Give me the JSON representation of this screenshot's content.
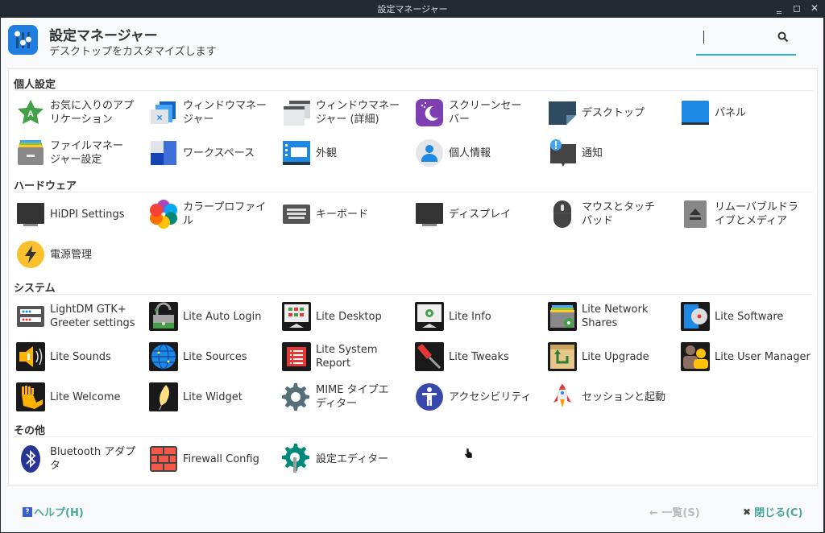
{
  "window": {
    "title": "設定マネージャー",
    "controls": [
      "minimize",
      "maximize",
      "close"
    ]
  },
  "header": {
    "title": "設定マネージャー",
    "subtitle": "デスクトップをカスタマイズします",
    "search": {
      "value": "",
      "placeholder": ""
    }
  },
  "sections": [
    {
      "title": "個人設定",
      "items": [
        {
          "label": "お気に入りのアプ\nリケーション",
          "icon": "favorite-apps-icon"
        },
        {
          "label": "ウィンドウマネー\nジャー",
          "icon": "window-manager-icon"
        },
        {
          "label": "ウィンドウマネー\nジャー (詳細)",
          "icon": "window-manager-tweaks-icon"
        },
        {
          "label": "スクリーンセー\nバー",
          "icon": "screensaver-icon"
        },
        {
          "label": "デスクトップ",
          "icon": "desktop-icon"
        },
        {
          "label": "パネル",
          "icon": "panel-icon"
        },
        {
          "label": "ファイルマネー\nジャー設定",
          "icon": "file-manager-icon"
        },
        {
          "label": "ワークスペース",
          "icon": "workspaces-icon"
        },
        {
          "label": "外観",
          "icon": "appearance-icon"
        },
        {
          "label": "個人情報",
          "icon": "user-info-icon"
        },
        {
          "label": "通知",
          "icon": "notifications-icon"
        }
      ]
    },
    {
      "title": "ハードウェア",
      "items": [
        {
          "label": "HiDPI Settings",
          "icon": "hidpi-monitor-icon"
        },
        {
          "label": "カラープロファイ\nル",
          "icon": "color-profile-icon"
        },
        {
          "label": "キーボード",
          "icon": "keyboard-icon"
        },
        {
          "label": "ディスプレイ",
          "icon": "display-icon"
        },
        {
          "label": "マウスとタッチ\nパッド",
          "icon": "mouse-icon"
        },
        {
          "label": "リムーバブルドラ\nイブとメディア",
          "icon": "removable-media-icon"
        },
        {
          "label": "電源管理",
          "icon": "power-manager-icon"
        }
      ]
    },
    {
      "title": "システム",
      "items": [
        {
          "label": "LightDM GTK+\nGreeter settings",
          "icon": "lightdm-icon"
        },
        {
          "label": "Lite Auto Login",
          "icon": "lite-auto-login-icon"
        },
        {
          "label": "Lite Desktop",
          "icon": "lite-desktop-icon"
        },
        {
          "label": "Lite Info",
          "icon": "lite-info-icon"
        },
        {
          "label": "Lite Network\nShares",
          "icon": "lite-network-shares-icon"
        },
        {
          "label": "Lite Software",
          "icon": "lite-software-icon"
        },
        {
          "label": "Lite Sounds",
          "icon": "lite-sounds-icon"
        },
        {
          "label": "Lite Sources",
          "icon": "lite-sources-icon"
        },
        {
          "label": "Lite System\nReport",
          "icon": "lite-system-report-icon"
        },
        {
          "label": "Lite Tweaks",
          "icon": "lite-tweaks-icon"
        },
        {
          "label": "Lite Upgrade",
          "icon": "lite-upgrade-icon"
        },
        {
          "label": "Lite User Manager",
          "icon": "lite-user-manager-icon"
        },
        {
          "label": "Lite Welcome",
          "icon": "lite-welcome-icon"
        },
        {
          "label": "Lite Widget",
          "icon": "lite-widget-icon"
        },
        {
          "label": "MIME タイプエ\nディター",
          "icon": "mime-editor-icon"
        },
        {
          "label": "アクセシビリティ",
          "icon": "accessibility-icon"
        },
        {
          "label": "セッションと起動",
          "icon": "session-startup-icon"
        }
      ]
    },
    {
      "title": "その他",
      "items": [
        {
          "label": "Bluetooth アダプ\nタ",
          "icon": "bluetooth-icon"
        },
        {
          "label": "Firewall Config",
          "icon": "firewall-icon"
        },
        {
          "label": "設定エディター",
          "icon": "settings-editor-icon"
        }
      ]
    }
  ],
  "footer": {
    "help": "ヘルプ(H)",
    "back": "← 一覧(S)",
    "close": "閉じる(C)"
  },
  "colors": {
    "accent": "#26b6d1",
    "link": "#4aa89a",
    "titlebar": "#232a31"
  }
}
